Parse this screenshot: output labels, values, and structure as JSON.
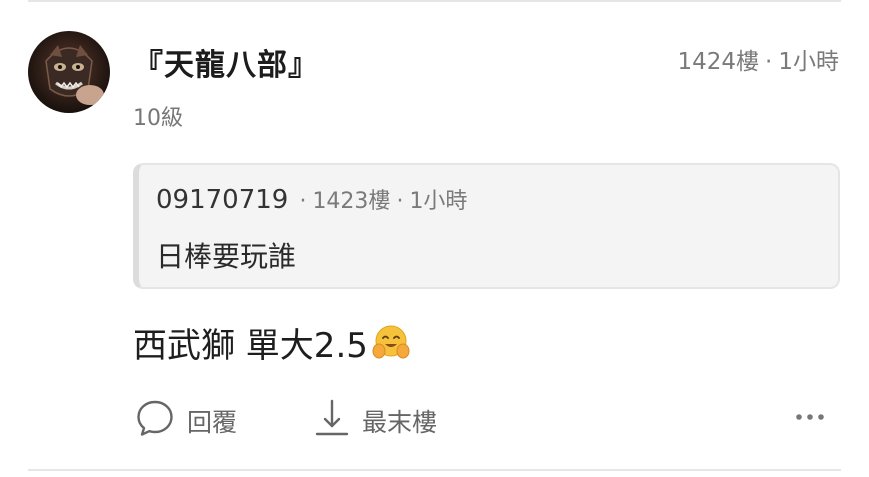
{
  "post": {
    "username": "『天龍八部』",
    "level": "10級",
    "floor": "1424樓",
    "time": "1小時",
    "separator": "·",
    "body_text": "西武獅 單大2.5"
  },
  "quote": {
    "author": "09170719",
    "floor": "1423樓",
    "time": "1小時",
    "separator": "·",
    "text": "日棒要玩誰"
  },
  "actions": {
    "reply_label": "回覆",
    "last_floor_label": "最末樓"
  },
  "icons": {
    "avatar": "demon-mask-avatar",
    "emoji": "hugging-face-emoji",
    "reply": "speech-bubble-icon",
    "last_floor": "arrow-down-to-line-icon",
    "more": "more-dots-icon"
  }
}
